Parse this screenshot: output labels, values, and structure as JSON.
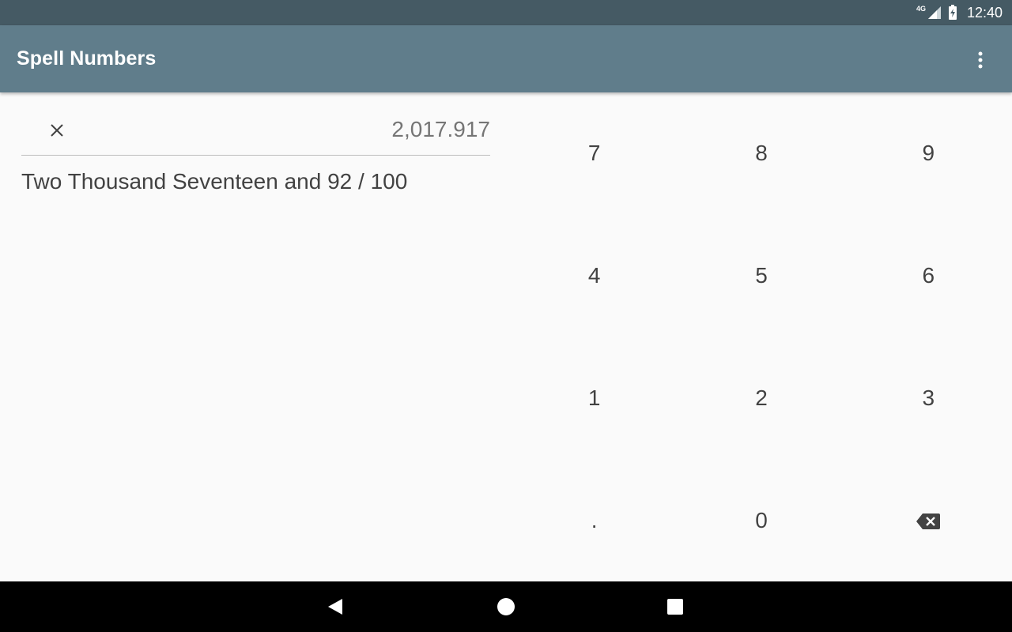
{
  "status_bar": {
    "network_label": "4G",
    "time": "12:40"
  },
  "app_bar": {
    "title": "Spell Numbers"
  },
  "input": {
    "value": "2,017.917"
  },
  "result": {
    "spelled_text": "Two Thousand Seventeen and 92 / 100"
  },
  "keypad": {
    "keys": [
      "7",
      "8",
      "9",
      "4",
      "5",
      "6",
      "1",
      "2",
      "3",
      ".",
      "0"
    ]
  },
  "colors": {
    "status_bar": "#455a64",
    "app_bar": "#607d8b",
    "background": "#fafafa",
    "text": "#424242",
    "input_text": "#757575"
  },
  "icons": {
    "overflow": "more-vert-icon",
    "clear": "close-icon",
    "backspace": "backspace-icon",
    "signal": "signal-icon",
    "battery": "battery-icon",
    "nav_back": "back-triangle-icon",
    "nav_home": "home-circle-icon",
    "nav_recents": "recents-square-icon"
  }
}
